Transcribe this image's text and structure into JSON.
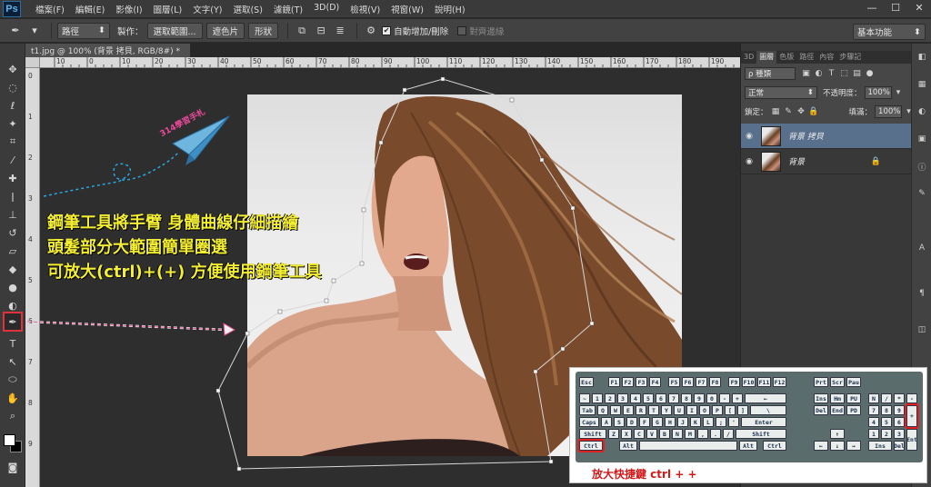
{
  "app": {
    "logo": "Ps"
  },
  "menu": [
    "檔案(F)",
    "編輯(E)",
    "影像(I)",
    "圖層(L)",
    "文字(Y)",
    "選取(S)",
    "濾鏡(T)",
    "3D(D)",
    "檢視(V)",
    "視窗(W)",
    "說明(H)"
  ],
  "window_controls": [
    "—",
    "☐",
    "✕"
  ],
  "options": {
    "mode_value": "路徑",
    "make_label": "製作：",
    "selection_btn": "選取範圍...",
    "mask_btn": "遮色片",
    "shape_btn": "形狀",
    "auto_add_delete": "自動增加/刪除",
    "align_edges": "對齊邊緣",
    "workspace": "基本功能"
  },
  "document": {
    "tab_title": "t1.jpg @ 100% (背景 拷貝, RGB/8#) *"
  },
  "rulers": {
    "top": [
      "10",
      "0",
      "10",
      "20",
      "30",
      "40",
      "50",
      "60",
      "70",
      "80",
      "90",
      "100",
      "110",
      "120",
      "130",
      "140",
      "150",
      "160",
      "170",
      "180",
      "190"
    ],
    "left": [
      "0",
      "1",
      "2",
      "3",
      "4",
      "5",
      "6",
      "7",
      "8",
      "9"
    ]
  },
  "panels": {
    "tabs": [
      "3D",
      "圖層",
      "色版",
      "路徑",
      "內容",
      "步驟記"
    ],
    "kind_filter": "ρ 種類",
    "blend_mode": "正常",
    "opacity_label": "不透明度：",
    "opacity_value": "100%",
    "lock_label": "鎖定：",
    "fill_label": "填滿：",
    "fill_value": "100%",
    "layers": [
      {
        "name": "背景 拷貝",
        "selected": true
      },
      {
        "name": "背景",
        "selected": false
      }
    ]
  },
  "annotation": {
    "lines": [
      "鋼筆工具將手臂 身體曲線仔細描繪",
      "頭髮部分大範圍簡單圈選",
      "可放大(ctrl)+(+) 方便使用鋼筆工具"
    ],
    "plane_text": "314學習手札",
    "keyboard_caption": "放大快捷鍵 ctrl + +"
  },
  "colors": {
    "annotation_text": "#f3ee33",
    "highlight": "#e0323a",
    "selected_layer": "#59708c"
  }
}
